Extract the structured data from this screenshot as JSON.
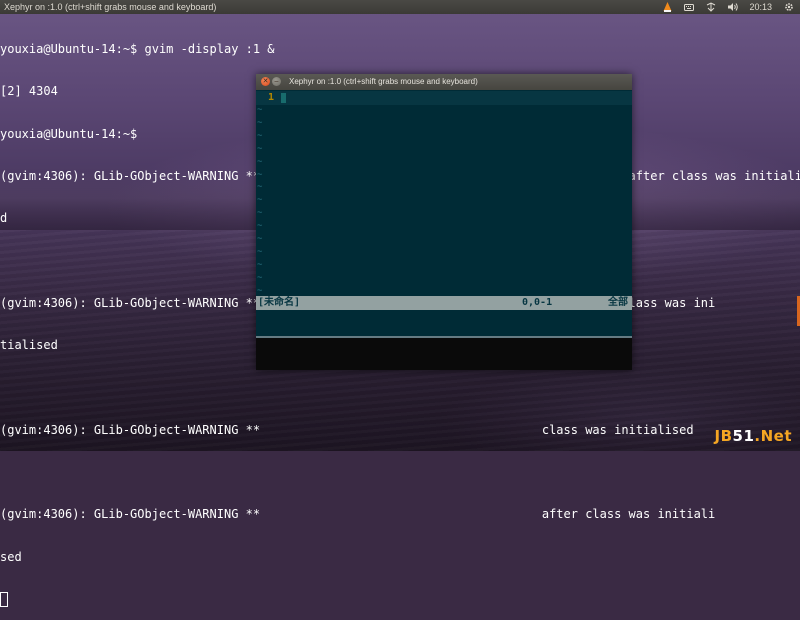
{
  "top_panel": {
    "title": "Xephyr on :1.0 (ctrl+shift grabs mouse and keyboard)",
    "icons": [
      "vlc-icon",
      "keyboard-icon",
      "network-icon",
      "volume-icon",
      "settings-gear-icon"
    ],
    "clock": "20:13"
  },
  "terminal": {
    "lines": [
      "youxia@Ubuntu-14:~$ gvim -display :1 &",
      "[2] 4304",
      "youxia@Ubuntu-14:~$",
      "(gvim:4306): GLib-GObject-WARNING **: Attempt to add property GnomeProgram::sm-connect after class was initialise",
      "d",
      "",
      "(gvim:4306): GLib-GObject-WARNING **                                       alog after class was ini",
      "tialised",
      "",
      "(gvim:4306): GLib-GObject-WARNING **                                       class was initialised",
      "",
      "(gvim:4306): GLib-GObject-WARNING **                                       after class was initiali",
      "sed"
    ]
  },
  "xephyr": {
    "title": "Xephyr on :1.0 (ctrl+shift grabs mouse and keyboard)",
    "close_symbol": "✕",
    "minimize_symbol": "–",
    "vim": {
      "line_number": "1",
      "tilde": "~",
      "tilde_count": 15,
      "status_filename": "[未命名]",
      "status_position": "0,0-1",
      "status_scroll": "全部"
    }
  },
  "watermark": {
    "part1": "JB",
    "part2": "51",
    "part3": ".Net"
  }
}
